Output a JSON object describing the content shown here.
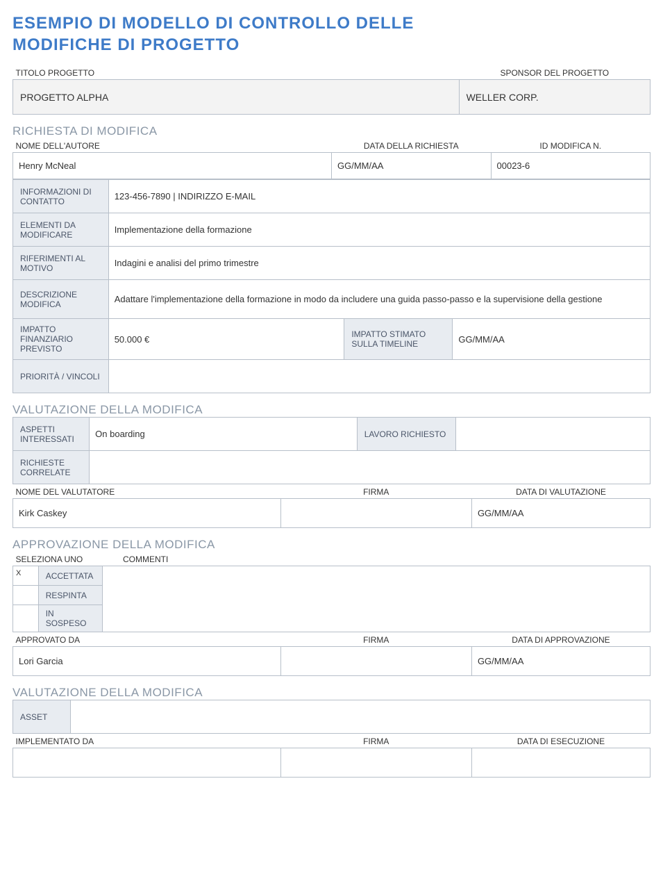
{
  "title_line1": "ESEMPIO DI MODELLO DI CONTROLLO DELLE",
  "title_line2": "MODIFICHE DI PROGETTO",
  "project": {
    "title_label": "TITOLO PROGETTO",
    "sponsor_label": "SPONSOR DEL PROGETTO",
    "title_value": "PROGETTO ALPHA",
    "sponsor_value": "WELLER CORP."
  },
  "request": {
    "section": "RICHIESTA DI MODIFICA",
    "author_label": "NOME DELL'AUTORE",
    "date_label": "DATA DELLA RICHIESTA",
    "id_label": "ID MODIFICA N.",
    "author_value": "Henry McNeal",
    "date_value": "GG/MM/AA",
    "id_value": "00023-6",
    "contact_label": "INFORMAZIONI DI CONTATTO",
    "contact_value": "123-456-7890 | INDIRIZZO E-MAIL",
    "elements_label": "ELEMENTI DA MODIFICARE",
    "elements_value": "Implementazione della formazione",
    "reason_label": "RIFERIMENTI AL MOTIVO",
    "reason_value": "Indagini e analisi del primo trimestre",
    "desc_label": "DESCRIZIONE MODIFICA",
    "desc_value": "Adattare l'implementazione della formazione in modo da includere una guida passo-passo e la supervisione della gestione",
    "fin_label": "IMPATTO FINANZIARIO PREVISTO",
    "fin_value": "50.000 €",
    "timeline_label": "IMPATTO STIMATO SULLA TIMELINE",
    "timeline_value": "GG/MM/AA",
    "priority_label": "PRIORITÀ / VINCOLI",
    "priority_value": ""
  },
  "eval": {
    "section": "VALUTAZIONE DELLA MODIFICA",
    "aspects_label": "ASPETTI INTERESSATI",
    "aspects_value": "On boarding",
    "work_label": "LAVORO RICHIESTO",
    "work_value": "",
    "related_label": "RICHIESTE CORRELATE",
    "related_value": "",
    "evaluator_label": "NOME DEL VALUTATORE",
    "sign_label": "FIRMA",
    "date_label": "DATA DI VALUTAZIONE",
    "evaluator_value": "Kirk Caskey",
    "sign_value": "",
    "date_value": "GG/MM/AA"
  },
  "approval": {
    "section": "APPROVAZIONE DELLA MODIFICA",
    "select_label": "SELEZIONA UNO",
    "comments_label": "COMMENTI",
    "accepted_mark": "X",
    "accepted": "ACCETTATA",
    "rejected": "RESPINTA",
    "pending": "IN SOSPESO",
    "approved_by_label": "APPROVATO DA",
    "sign_label": "FIRMA",
    "date_label": "DATA DI APPROVAZIONE",
    "approved_by_value": "Lori Garcia",
    "sign_value": "",
    "date_value": "GG/MM/AA"
  },
  "impl": {
    "section": "VALUTAZIONE DELLA MODIFICA",
    "asset_label": "ASSET",
    "asset_value": "",
    "impl_by_label": "IMPLEMENTATO DA",
    "sign_label": "FIRMA",
    "date_label": "DATA DI ESECUZIONE",
    "impl_by_value": "",
    "sign_value": "",
    "date_value": ""
  }
}
